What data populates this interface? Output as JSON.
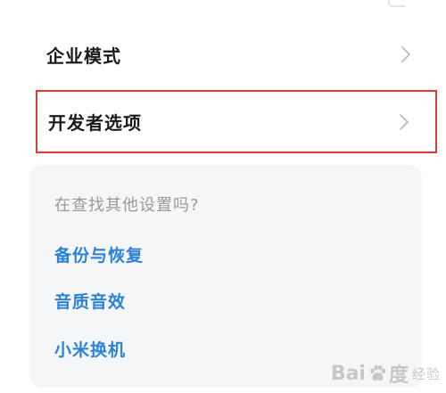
{
  "settings_list": {
    "items": [
      {
        "label": "企业模式"
      },
      {
        "label": "开发者选项",
        "highlighted": true
      }
    ],
    "highlight_color": "#e23a35"
  },
  "suggestions_card": {
    "prompt": "在查找其他设置吗?",
    "links": [
      {
        "label": "备份与恢复"
      },
      {
        "label": "音质音效"
      },
      {
        "label": "小米换机"
      }
    ],
    "link_color": "#2b82d9"
  },
  "watermark": {
    "brand_left": "Bai",
    "brand_right": "度",
    "sub": "经验"
  },
  "icons": {
    "row_chevron": "chevron-right-icon",
    "watermark_paw": "paw-icon"
  }
}
